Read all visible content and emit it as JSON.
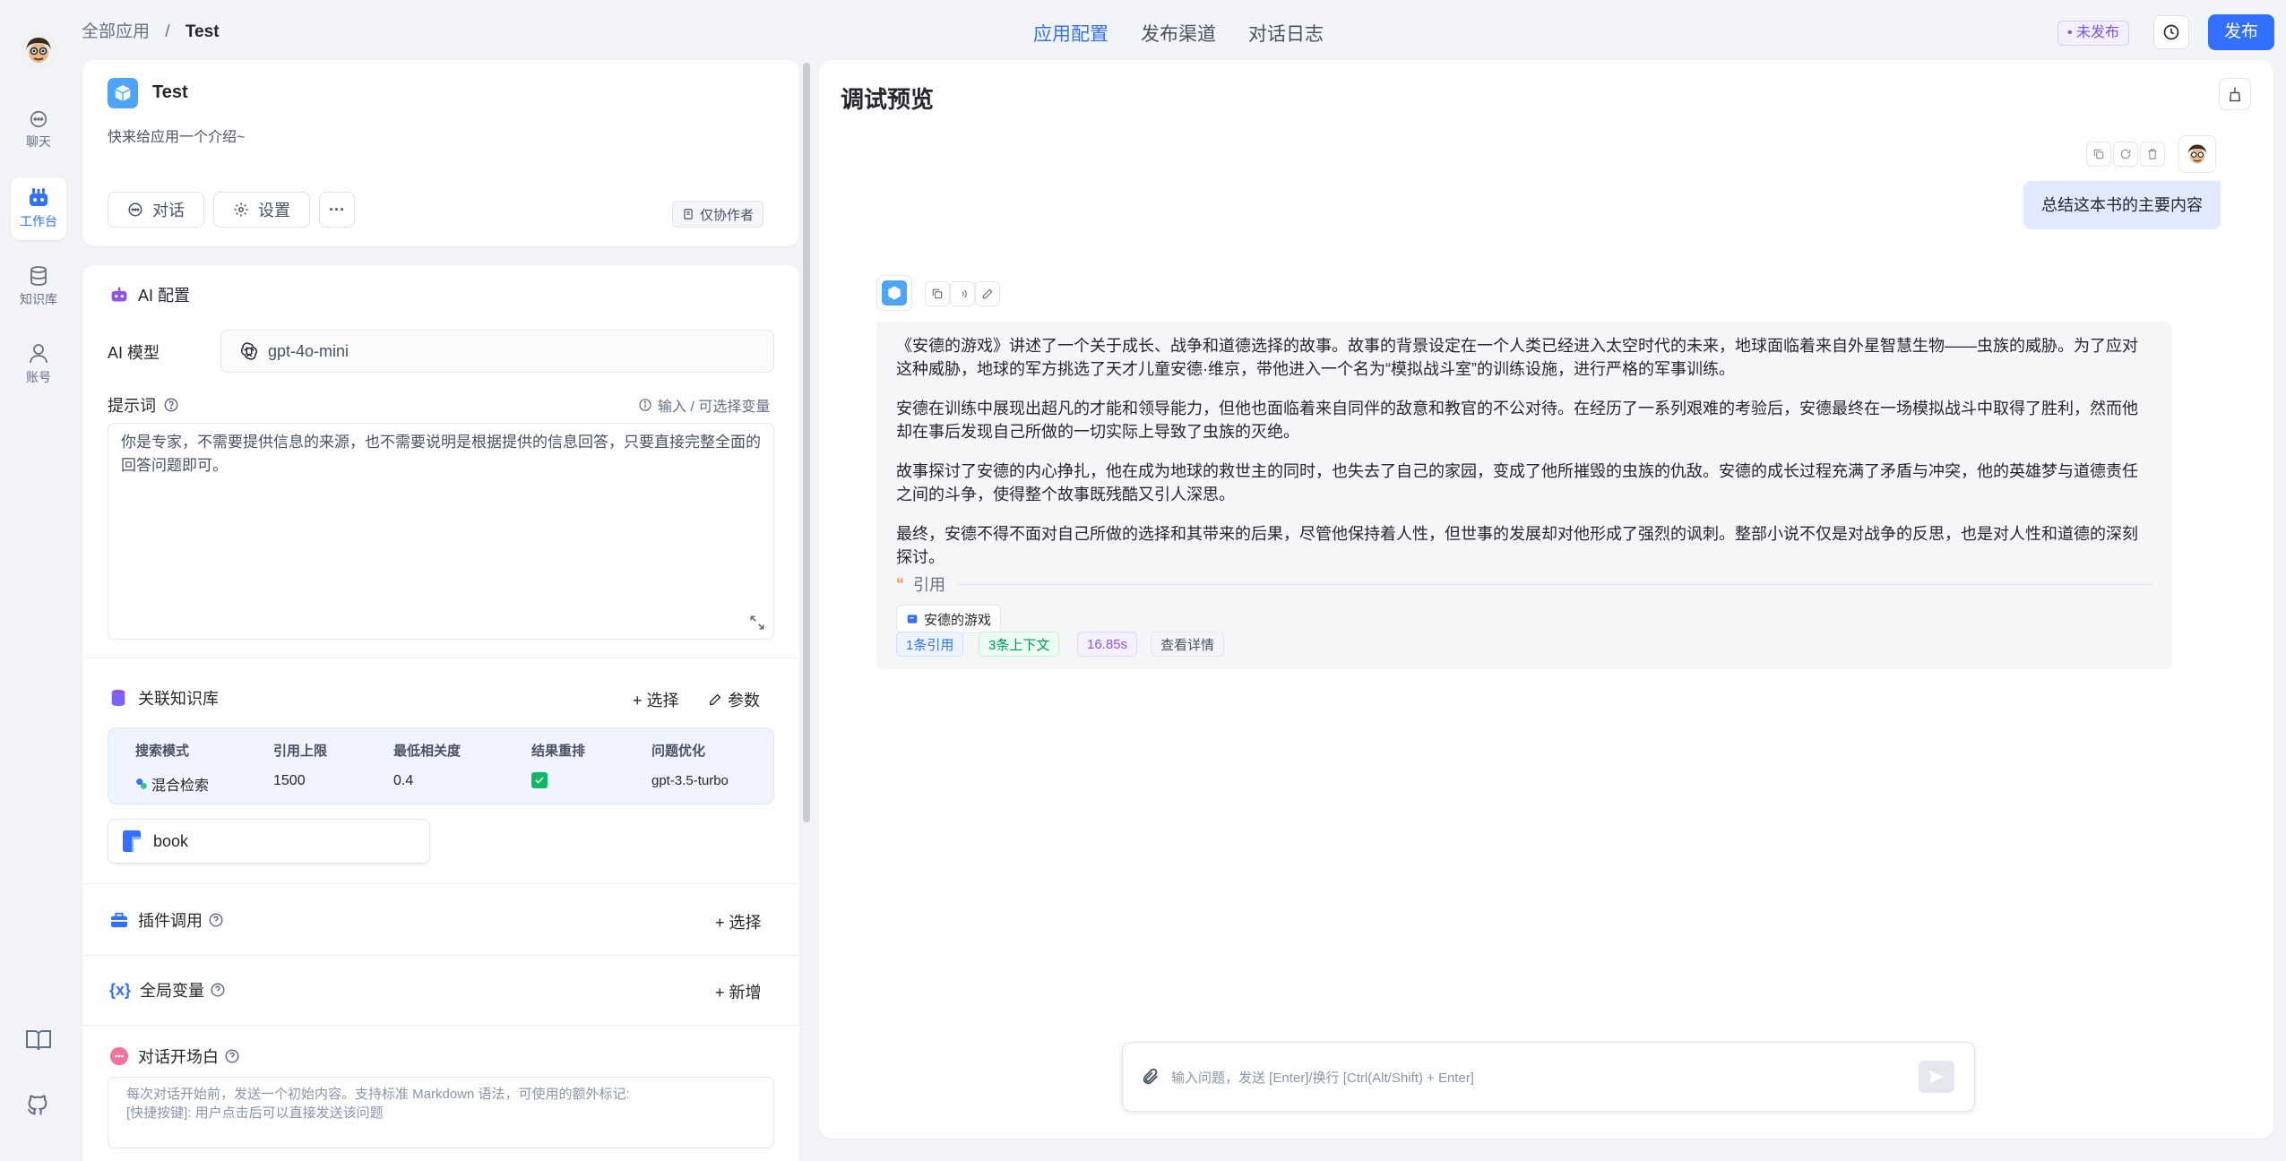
{
  "breadcrumb": {
    "root": "全部应用",
    "sep": "/",
    "current": "Test"
  },
  "top_tabs": [
    "应用配置",
    "发布渠道",
    "对话日志"
  ],
  "top_right": {
    "status": "• 未发布",
    "publish": "发布"
  },
  "nav": [
    {
      "label": "聊天",
      "icon": "chat-icon"
    },
    {
      "label": "工作台",
      "icon": "robot-icon"
    },
    {
      "label": "知识库",
      "icon": "database-icon"
    },
    {
      "label": "账号",
      "icon": "user-icon"
    }
  ],
  "app": {
    "name": "Test",
    "intro": "快来给应用一个介绍~",
    "chat_btn": "对话",
    "settings_btn": "设置",
    "more": "···",
    "collab": "仅协作者"
  },
  "ai_config": {
    "title": "AI 配置",
    "model_label": "AI 模型",
    "model_value": "gpt-4o-mini",
    "prompt_label": "提示词",
    "prompt_hint": "输入 / 可选择变量",
    "prompt_text": "你是专家，不需要提供信息的来源，也不需要说明是根据提供的信息回答，只要直接完整全面的回答问题即可。"
  },
  "kb": {
    "title": "关联知识库",
    "select": "+ 选择",
    "params": "参数",
    "headers": [
      "搜索模式",
      "引用上限",
      "最低相关度",
      "结果重排",
      "问题优化"
    ],
    "row": [
      "混合检索",
      "1500",
      "0.4",
      "",
      "gpt-3.5-turbo"
    ],
    "dataset": "book"
  },
  "plugins": {
    "title": "插件调用",
    "action": "+ 选择"
  },
  "variables": {
    "title": "全局变量",
    "action": "+ 新增"
  },
  "welcome": {
    "title": "对话开场白",
    "line1": "每次对话开始前，发送一个初始内容。支持标准 Markdown 语法，可使用的额外标记:",
    "line2": "[快捷按键]: 用户点击后可以直接发送该问题"
  },
  "preview": {
    "title": "调试预览",
    "user_msg": "总结这本书的主要内容",
    "answer": [
      "《安德的游戏》讲述了一个关于成长、战争和道德选择的故事。故事的背景设定在一个人类已经进入太空时代的未来，地球面临着来自外星智慧生物——虫族的威胁。为了应对这种威胁，地球的军方挑选了天才儿童安德·维京，带他进入一个名为“模拟战斗室”的训练设施，进行严格的军事训练。",
      "安德在训练中展现出超凡的才能和领导能力，但他也面临着来自同伴的敌意和教官的不公对待。在经历了一系列艰难的考验后，安德最终在一场模拟战斗中取得了胜利，然而他却在事后发现自己所做的一切实际上导致了虫族的灭绝。",
      "故事探讨了安德的内心挣扎，他在成为地球的救世主的同时，也失去了自己的家园，变成了他所摧毁的虫族的仇敌。安德的成长过程充满了矛盾与冲突，他的英雄梦与道德责任之间的斗争，使得整个故事既残酷又引人深思。",
      "最终，安德不得不面对自己所做的选择和其带来的后果，尽管他保持着人性，但世事的发展却对他形成了强烈的讽刺。整部小说不仅是对战争的反思，也是对人性和道德的深刻探讨。"
    ],
    "quote_label": "引用",
    "source": "安德的游戏",
    "tags": [
      "1条引用",
      "3条上下文",
      "16.85s",
      "查看详情"
    ],
    "input_placeholder": "输入问题，发送 [Enter]/换行 [Ctrl(Alt/Shift) + Enter]"
  },
  "colors": {
    "accent": "#3370ff",
    "green": "#12b76a",
    "purple": "#8e54e9"
  }
}
